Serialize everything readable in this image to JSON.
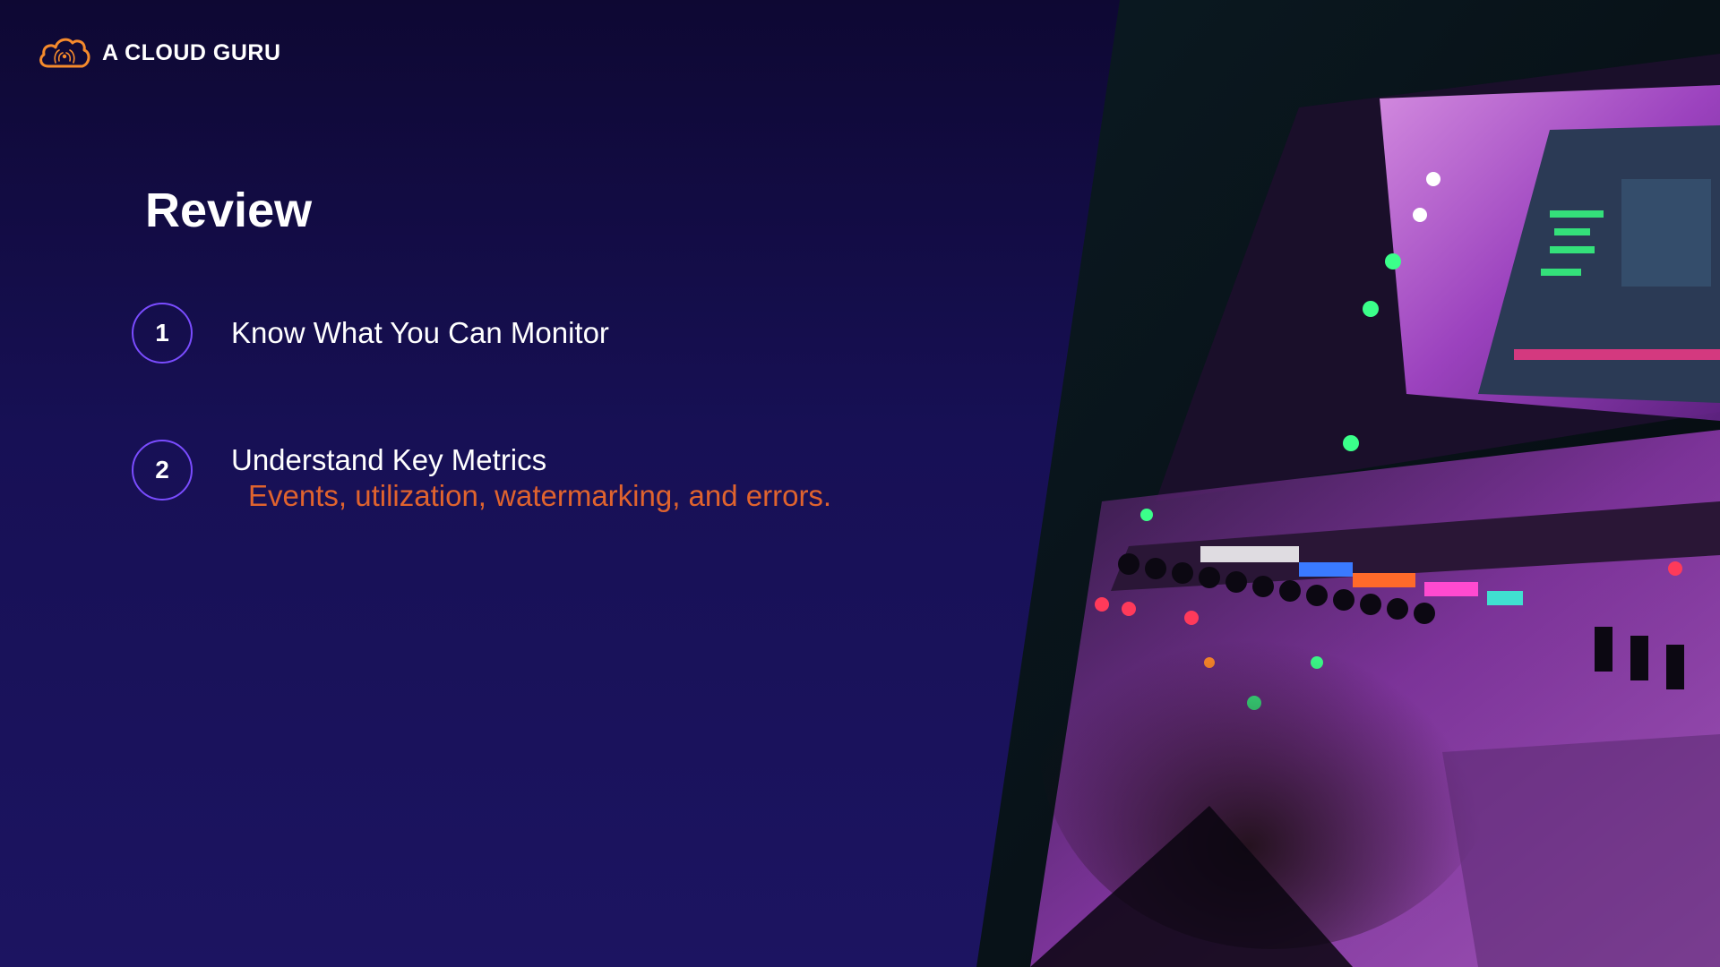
{
  "brand": {
    "logo_icon": "cloud-logo-icon",
    "name": "A CLOUD GURU",
    "accent_color": "#f58a2c"
  },
  "slide": {
    "title": "Review",
    "items": [
      {
        "number": "1",
        "label": "Know What You Can Monitor",
        "subtitle": ""
      },
      {
        "number": "2",
        "label": "Understand Key Metrics",
        "subtitle": "Events, utilization, watermarking, and errors."
      }
    ],
    "circle_color": "#7a4cff",
    "subtitle_color": "#e0632e"
  },
  "photo": {
    "subject": "audio-mixing-console-photo"
  }
}
